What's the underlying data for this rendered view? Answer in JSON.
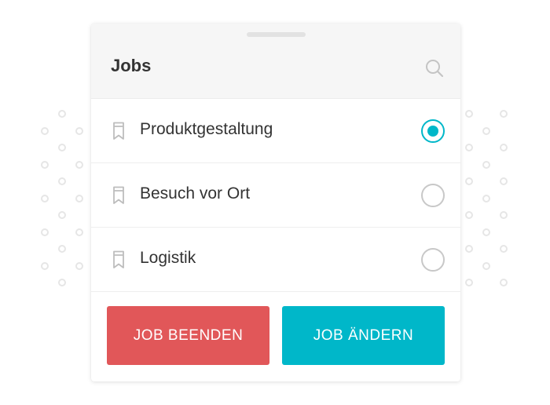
{
  "panel": {
    "title": "Jobs",
    "search_icon": "search-icon"
  },
  "jobs": [
    {
      "label": "Produktgestaltung",
      "selected": true,
      "icon": "bookmark-icon"
    },
    {
      "label": "Besuch vor Ort",
      "selected": false,
      "icon": "bookmark-icon"
    },
    {
      "label": "Logistik",
      "selected": false,
      "icon": "bookmark-icon"
    }
  ],
  "actions": {
    "end_label": "JOB BEENDEN",
    "change_label": "JOB ÄNDERN"
  },
  "colors": {
    "accent": "#00b7c9",
    "danger": "#e15759",
    "header_bg": "#f6f6f6"
  }
}
